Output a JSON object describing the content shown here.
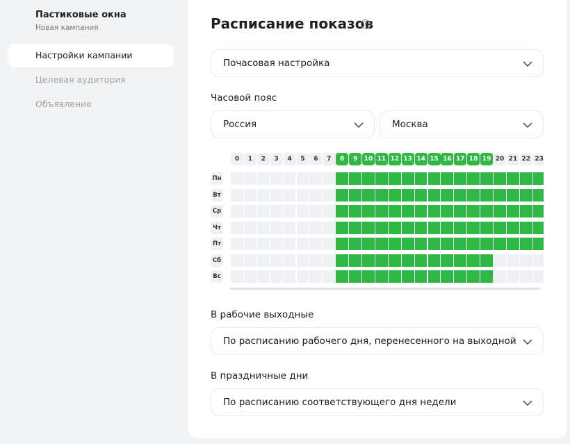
{
  "sidebar": {
    "campaign_title": "Пастиковые окна",
    "campaign_subtitle": "Новая кампания",
    "items": [
      {
        "label": "Настройки кампании",
        "active": true
      },
      {
        "label": "Целевая аудитория",
        "active": false
      },
      {
        "label": "Объявление",
        "active": false
      }
    ]
  },
  "main": {
    "title": "Расписание показов",
    "help_icon": "question-circle-icon",
    "schedule_mode": "Почасовая настройка",
    "timezone_label": "Часовой пояс",
    "country": "Россия",
    "city": "Москва",
    "weekend_label": "В рабочие выходные",
    "weekend_value": "По расписанию рабочего дня, перенесенного на выходной",
    "holiday_label": "В праздничные дни",
    "holiday_value": "По расписанию соответствующего дня недели"
  },
  "schedule": {
    "hours": [
      "0",
      "1",
      "2",
      "3",
      "4",
      "5",
      "6",
      "7",
      "8",
      "9",
      "10",
      "11",
      "12",
      "13",
      "14",
      "15",
      "16",
      "17",
      "18",
      "19",
      "20",
      "21",
      "22",
      "23"
    ],
    "highlighted_hours": [
      "8",
      "9",
      "10",
      "11",
      "12",
      "13",
      "14",
      "15",
      "16",
      "17",
      "18",
      "19"
    ],
    "days": [
      "Пн",
      "Вт",
      "Ср",
      "Чт",
      "Пт",
      "Сб",
      "Вс"
    ],
    "active_ranges": [
      {
        "day": "Пн",
        "from": 8,
        "to": 23
      },
      {
        "day": "Вт",
        "from": 8,
        "to": 23
      },
      {
        "day": "Ср",
        "from": 8,
        "to": 23
      },
      {
        "day": "Чт",
        "from": 8,
        "to": 23
      },
      {
        "day": "Пт",
        "from": 8,
        "to": 23
      },
      {
        "day": "Сб",
        "from": 8,
        "to": 19
      },
      {
        "day": "Вс",
        "from": 8,
        "to": 19
      }
    ]
  },
  "colors": {
    "accent_green": "#2fb844",
    "inactive_cell": "#eef0f3",
    "background": "#f2f3f5"
  }
}
